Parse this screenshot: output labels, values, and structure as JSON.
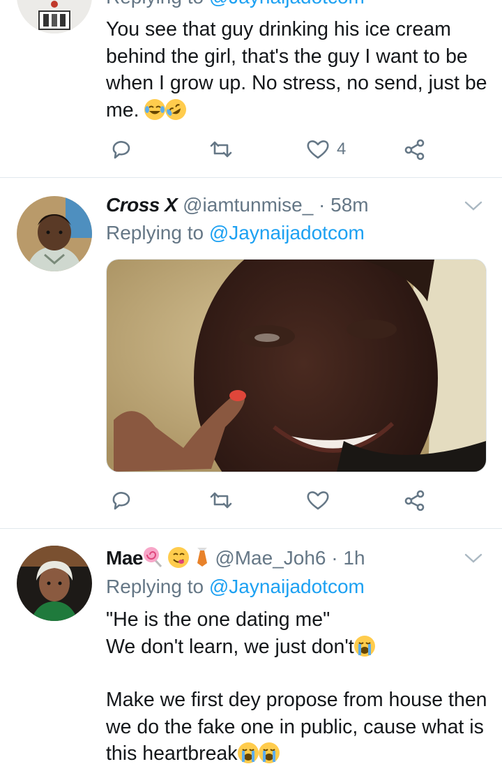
{
  "tweet1": {
    "reply_prefix": "Replying to",
    "reply_handle": "@Jaynaijadotcom",
    "text": "You see that guy drinking his ice cream behind the girl, that's the guy I want to be when I grow up. No stress, no send, just be me.",
    "emojis": [
      "face-with-tears-of-joy",
      "rolling-on-the-floor-laughing"
    ],
    "like_count": "4"
  },
  "tweet2": {
    "name": "Cross X",
    "handle": "@iamtunmise_",
    "time": "· 58m",
    "reply_prefix": "Replying to",
    "reply_handle": "@Jaynaijadotcom",
    "media": "video-thumbnail"
  },
  "tweet3": {
    "name": "Mae",
    "name_emojis": [
      "lollipop",
      "face-savoring-food",
      "necktie"
    ],
    "handle": "@Mae_Joh6",
    "time": "· 1h",
    "reply_prefix": "Replying to",
    "reply_handle": "@Jaynaijadotcom",
    "line1": "\"He is the one dating me\"",
    "line2": "We don't learn, we just don't",
    "line3": "Make we first dey propose from house then we do the fake one in public, cause what is this heartbreak",
    "emojis": [
      "loudly-crying-face"
    ]
  },
  "colors": {
    "text": "#14171a",
    "secondary": "#657786",
    "link": "#1da1f2",
    "divider": "#e1e8ed"
  },
  "icons": [
    "reply-icon",
    "retweet-icon",
    "like-icon",
    "share-icon",
    "chevron-down-icon"
  ]
}
